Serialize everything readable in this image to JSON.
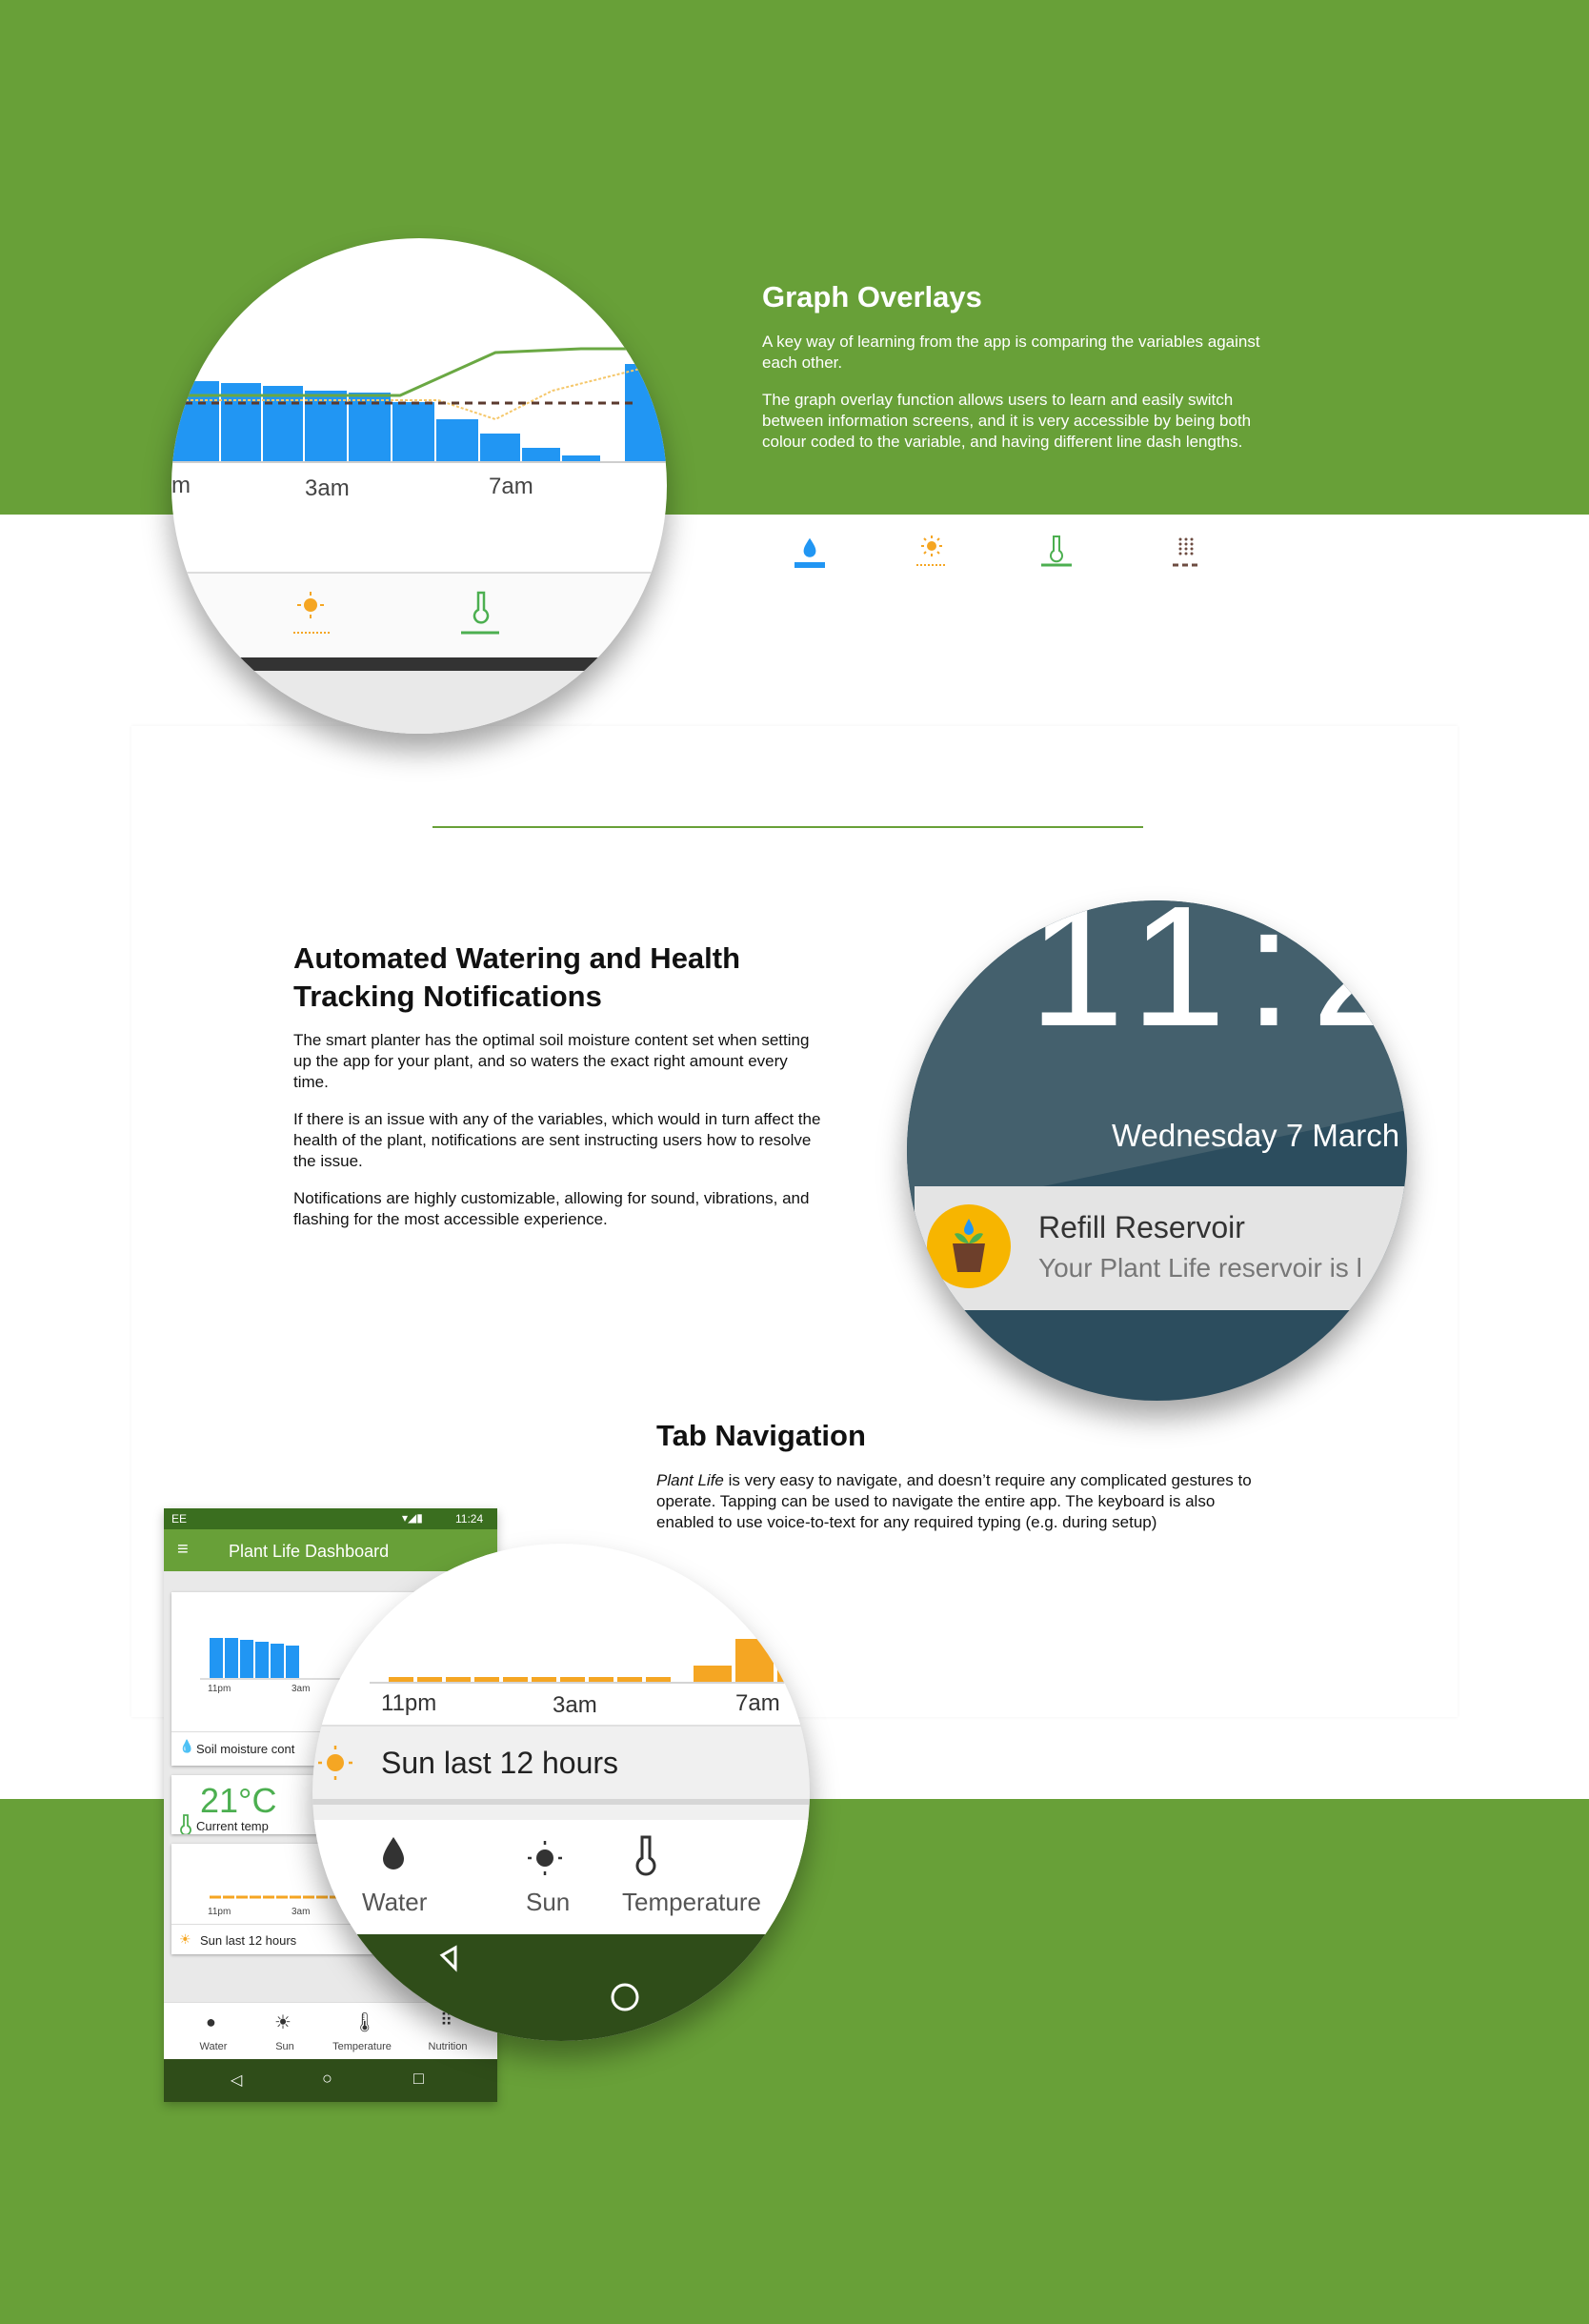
{
  "graph_overlays": {
    "title": "Graph Overlays",
    "para1": "A key way of learning from the app is comparing the variables against each other.",
    "para2": "The graph overlay function allows users to learn and easily switch between information screens, and it is very accessible by being both colour coded to the variable, and having different line dash lengths.",
    "zoom_labels": [
      "m",
      "3am",
      "7am"
    ],
    "legend": [
      {
        "icon": "water-drop-icon",
        "color": "#2196f3"
      },
      {
        "icon": "sun-icon",
        "color": "#f5a623"
      },
      {
        "icon": "thermometer-icon",
        "color": "#4caf50"
      },
      {
        "icon": "nutrition-icon",
        "color": "#6d4c41"
      }
    ]
  },
  "notifications": {
    "title_line1": "Automated Watering and Health",
    "title_line2": "Tracking Notifications",
    "para1": "The smart planter has the optimal soil moisture content set when setting up the app for your plant, and so waters the exact right amount every time.",
    "para2": "If there is an issue with any of the variables, which would in turn affect the health of the plant, notifications are sent instructing users how to resolve the issue.",
    "para3": "Notifications are highly customizable, allowing for sound, vibrations, and flashing for the most accessible experience.",
    "lock_time": "11:2",
    "lock_date": "Wednesday 7 March",
    "notif_title": "Refill Reservoir",
    "notif_body": "Your Plant Life reservoir is l"
  },
  "tab_navigation": {
    "title": "Tab Navigation",
    "para_italic": "Plant Life",
    "para_rest": " is very easy to navigate, and doesn’t require any complicated gestures to operate. Tapping can be used to navigate the entire app. The keyboard is also enabled to use voice-to-text for any required typing (e.g. during setup)"
  },
  "phone": {
    "carrier": "EE",
    "time": "11:24",
    "app_title": "Plant Life Dashboard",
    "card1_ticks": [
      "11pm",
      "3am"
    ],
    "card1_label": "Soil moisture cont",
    "temp_value": "21°C",
    "temp_label": "Current temp",
    "card3_ticks": [
      "11pm",
      "3am"
    ],
    "card3_label": "Sun last 12 hours",
    "nav": [
      "Water",
      "Sun",
      "Temperature",
      "Nutrition"
    ]
  },
  "zoom_sun": {
    "ticks": [
      "11pm",
      "3am",
      "7am"
    ],
    "label": "Sun last 12 hours",
    "nav": [
      "Water",
      "Sun",
      "Temperature"
    ]
  },
  "colors": {
    "brand_green": "#68a038",
    "dark_green": "#2f4d19",
    "water_blue": "#2196f3",
    "sun_orange": "#f5a623",
    "temp_green": "#4caf50",
    "nutrition_brown": "#6d4c41",
    "lock_teal": "#2c4d5e"
  }
}
